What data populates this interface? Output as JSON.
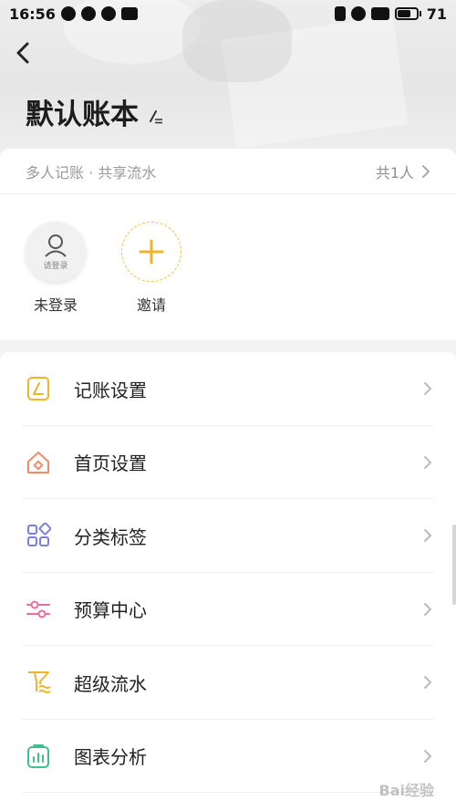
{
  "status_bar": {
    "time": "16:56",
    "battery": "71"
  },
  "header": {
    "title": "默认账本"
  },
  "share": {
    "subtitle": "多人记账 · 共享流水",
    "count": "共1人",
    "members": [
      {
        "name": "未登录",
        "avatar_text": "请登录"
      },
      {
        "name": "邀请"
      }
    ]
  },
  "menu": [
    {
      "label": "记账设置",
      "icon": "bookkeeping-settings-icon",
      "color": "#f0b429"
    },
    {
      "label": "首页设置",
      "icon": "home-icon",
      "color": "#ef8a6b"
    },
    {
      "label": "分类标签",
      "icon": "category-icon",
      "color": "#7b7fe0"
    },
    {
      "label": "预算中心",
      "icon": "budget-icon",
      "color": "#ef6d9a"
    },
    {
      "label": "超级流水",
      "icon": "flow-icon",
      "color": "#f0b429"
    },
    {
      "label": "图表分析",
      "icon": "chart-icon",
      "color": "#3fbf8f"
    }
  ],
  "colors": {
    "accent": "#f0b429",
    "background": "#f3f3f3",
    "card": "#ffffff"
  },
  "watermark": "Bai经验"
}
